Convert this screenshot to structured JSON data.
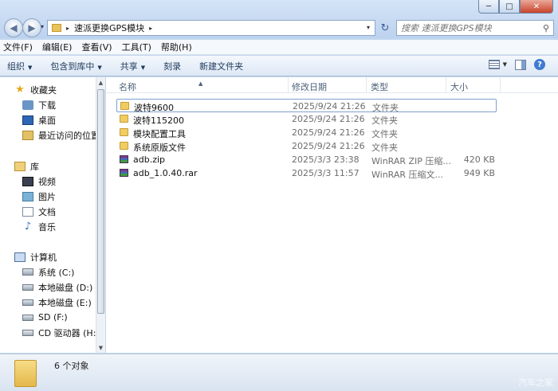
{
  "window": {
    "min_label": "─",
    "max_label": "□",
    "close_label": "✕"
  },
  "nav": {
    "back": "◀",
    "forward": "▶",
    "history": "▾"
  },
  "address": {
    "separator": "▸",
    "path": "速派更换GPS模块",
    "end_separator": "▸",
    "dropdown": "▾"
  },
  "refresh_label": "↻",
  "search": {
    "placeholder": "搜索 速派更换GPS模块",
    "icon": "⚲"
  },
  "menu": [
    "文件(F)",
    "编辑(E)",
    "查看(V)",
    "工具(T)",
    "帮助(H)"
  ],
  "toolbar": {
    "organize": "组织",
    "include_in_library": "包含到库中",
    "share": "共享",
    "burn": "刻录",
    "new_folder": "新建文件夹",
    "arrow": "▼",
    "help": "?"
  },
  "sidebar": {
    "favorites": {
      "header": "收藏夹",
      "items": [
        "下载",
        "桌面",
        "最近访问的位置"
      ]
    },
    "libraries": {
      "header": "库",
      "items": [
        "视频",
        "图片",
        "文档",
        "音乐"
      ]
    },
    "computer": {
      "header": "计算机",
      "items": [
        "系统 (C:)",
        "本地磁盘 (D:)",
        "本地磁盘 (E:)",
        "SD (F:)",
        "CD 驱动器 (H:)"
      ]
    }
  },
  "scroll": {
    "up": "▲",
    "down": "▼"
  },
  "columns": {
    "name": "名称",
    "modified": "修改日期",
    "type": "类型",
    "size": "大小",
    "sort_indicator": "▲"
  },
  "files": [
    {
      "name": "波特9600",
      "modified": "2025/9/24 21:26",
      "type": "文件夹",
      "size": "",
      "kind": "folder",
      "selected": true
    },
    {
      "name": "波特115200",
      "modified": "2025/9/24 21:26",
      "type": "文件夹",
      "size": "",
      "kind": "folder",
      "selected": false
    },
    {
      "name": "模块配置工具",
      "modified": "2025/9/24 21:26",
      "type": "文件夹",
      "size": "",
      "kind": "folder",
      "selected": false
    },
    {
      "name": "系统原版文件",
      "modified": "2025/9/24 21:26",
      "type": "文件夹",
      "size": "",
      "kind": "folder",
      "selected": false
    },
    {
      "name": "adb.zip",
      "modified": "2025/3/3 23:38",
      "type": "WinRAR ZIP 压缩...",
      "size": "420 KB",
      "kind": "archive",
      "selected": false
    },
    {
      "name": "adb_1.0.40.rar",
      "modified": "2025/3/3 11:57",
      "type": "WinRAR 压缩文...",
      "size": "949 KB",
      "kind": "archive",
      "selected": false
    }
  ],
  "status": {
    "count": "6 个对象"
  },
  "watermark": "汽车之家"
}
